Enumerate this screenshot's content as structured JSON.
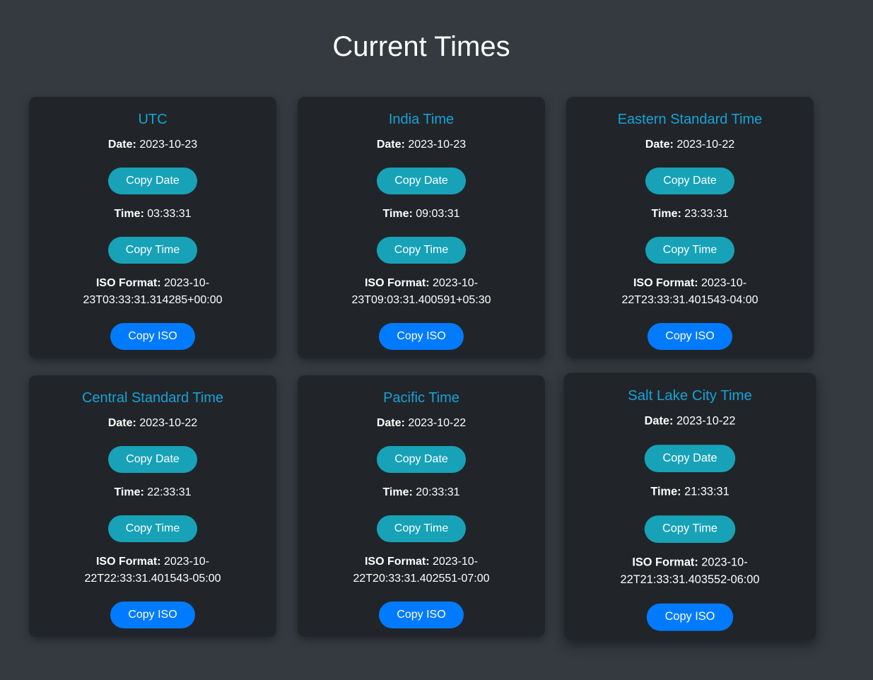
{
  "page": {
    "title": "Current Times"
  },
  "labels": {
    "date": "Date:",
    "time": "Time:",
    "iso": "ISO Format:",
    "copy_date": "Copy Date",
    "copy_time": "Copy Time",
    "copy_iso": "Copy ISO"
  },
  "zones": [
    {
      "name": "UTC",
      "date": "2023-10-23",
      "time": "03:33:31",
      "iso_line1": "2023-10-",
      "iso_line2": "23T03:33:31.314285+00:00"
    },
    {
      "name": "India Time",
      "date": "2023-10-23",
      "time": "09:03:31",
      "iso_line1": "2023-10-",
      "iso_line2": "23T09:03:31.400591+05:30"
    },
    {
      "name": "Eastern Standard Time",
      "date": "2023-10-22",
      "time": "23:33:31",
      "iso_line1": "2023-10-",
      "iso_line2": "22T23:33:31.401543-04:00"
    },
    {
      "name": "Central Standard Time",
      "date": "2023-10-22",
      "time": "22:33:31",
      "iso_line1": "2023-10-",
      "iso_line2": "22T22:33:31.401543-05:00"
    },
    {
      "name": "Pacific Time",
      "date": "2023-10-22",
      "time": "20:33:31",
      "iso_line1": "2023-10-",
      "iso_line2": "22T20:33:31.402551-07:00"
    },
    {
      "name": "Salt Lake City Time",
      "date": "2023-10-22",
      "time": "21:33:31",
      "iso_line1": "2023-10-",
      "iso_line2": "22T21:33:31.403552-06:00"
    }
  ],
  "colors": {
    "background": "#343a40",
    "card": "#212529",
    "zone_title": "#17a2d8",
    "teal_button": "#17a2b8",
    "blue_button": "#007bff"
  }
}
